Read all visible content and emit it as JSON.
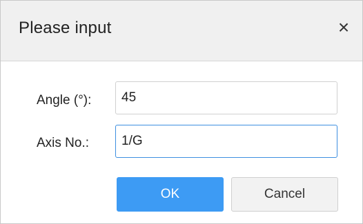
{
  "dialog": {
    "title": "Please input",
    "close_glyph": "×",
    "close_icon": "close-icon"
  },
  "form": {
    "angle": {
      "label": "Angle (°):",
      "value": "45"
    },
    "axis": {
      "label": "Axis No.:",
      "value": "1/G"
    }
  },
  "buttons": {
    "ok_label": "OK",
    "cancel_label": "Cancel"
  },
  "colors": {
    "ok_button": "#3d9bf4",
    "focus_border": "#3c8ee0",
    "titlebar_bg": "#f0f0f0"
  }
}
